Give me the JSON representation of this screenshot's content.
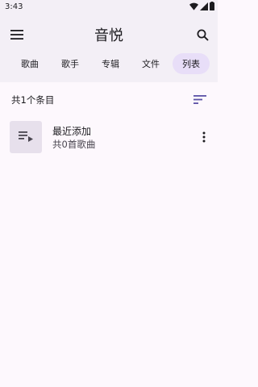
{
  "status_bar": {
    "time": "3:43",
    "icons": [
      "wifi-icon",
      "signal-icon",
      "battery-icon"
    ]
  },
  "app_bar": {
    "title": "音悦",
    "left_icon": "menu-icon",
    "right_icon": "search-icon"
  },
  "tabs": [
    {
      "label": "歌曲",
      "active": false
    },
    {
      "label": "歌手",
      "active": false
    },
    {
      "label": "专辑",
      "active": false
    },
    {
      "label": "文件",
      "active": false
    },
    {
      "label": "列表",
      "active": true
    }
  ],
  "list_header": {
    "count_text": "共1个条目",
    "sort_icon": "sort-icon"
  },
  "playlists": [
    {
      "title": "最近添加",
      "subtitle": "共0首歌曲",
      "icon": "playlist-play-icon",
      "more_icon": "more-vert-icon"
    }
  ],
  "colors": {
    "top_bg": "#f3eff6",
    "page_bg": "#fdf8fd",
    "active_tab": "#e8def8",
    "accent": "#5c52a7",
    "thumb_bg": "#e7e0ec"
  }
}
